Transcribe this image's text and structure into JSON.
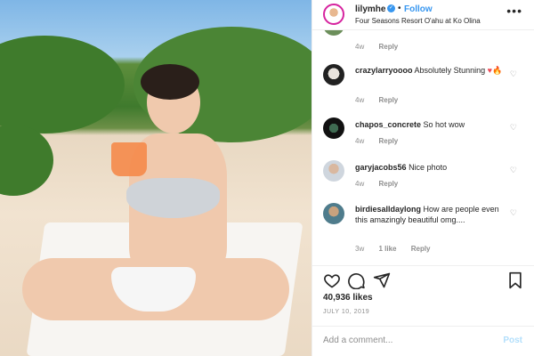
{
  "post": {
    "username": "lilymhe",
    "separator": "•",
    "follow_label": "Follow",
    "location": "Four Seasons Resort O'ahu at Ko Olina",
    "more_icon": "more-dots-icon"
  },
  "comments": [
    {
      "username": "",
      "text": "",
      "time": "4w",
      "likes": "",
      "reply": "Reply"
    },
    {
      "username": "crazylarryoooo",
      "text": "Absolutely Stunning",
      "emoji": [
        "heart",
        "fire"
      ],
      "time": "4w",
      "likes": "",
      "reply": "Reply"
    },
    {
      "username": "chapos_concrete",
      "text": "So hot wow",
      "time": "4w",
      "likes": "",
      "reply": "Reply"
    },
    {
      "username": "garyjacobs56",
      "text": "Nice photo",
      "time": "4w",
      "likes": "",
      "reply": "Reply"
    },
    {
      "username": "birdiesalldaylong",
      "text": "How are people even this amazingly beautiful omg....",
      "time": "3w",
      "likes": "1 like",
      "reply": "Reply"
    }
  ],
  "actions": {
    "likes": "40,936 likes",
    "date": "JULY 10, 2019"
  },
  "add_comment": {
    "placeholder": "Add a comment...",
    "post_label": "Post"
  },
  "colors": {
    "accent": "#3897f0",
    "muted": "#8e8e8e",
    "text": "#262626",
    "post_disabled": "#b2dffc"
  }
}
